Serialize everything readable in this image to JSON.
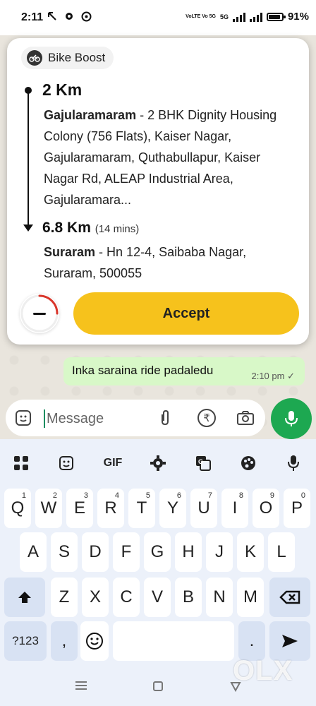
{
  "status_bar": {
    "time": "2:11",
    "network_label": "VoLTE Vo 5G",
    "network_type": "5G",
    "battery": "91%",
    "battery_level": 0.91
  },
  "ride_card": {
    "service_label": "Bike Boost",
    "pickup": {
      "distance": "2 Km",
      "place": "Gajularamaram",
      "address": " - 2 BHK Dignity Housing Colony (756 Flats), Kaiser Nagar, Gajularamaram, Quthabullapur, Kaiser Nagar Rd, ALEAP Industrial Area, Gajularamara..."
    },
    "drop": {
      "distance": "6.8 Km",
      "duration": "(14 mins)",
      "place": "Suraram",
      "address": " - Hn 12-4, Saibaba Nagar, Suraram, 500055"
    },
    "accept_label": "Accept",
    "timer_progress": 0.25,
    "accent_color": "#f6c21c"
  },
  "chat": {
    "message": "Inka saraina ride padaledu",
    "time": "2:10 pm",
    "tick": "✓"
  },
  "composer": {
    "placeholder": "Message",
    "rupee_symbol": "₹"
  },
  "keyboard": {
    "toolbar": {
      "gif_label": "GIF"
    },
    "row1": [
      {
        "k": "Q",
        "s": "1"
      },
      {
        "k": "W",
        "s": "2"
      },
      {
        "k": "E",
        "s": "3"
      },
      {
        "k": "R",
        "s": "4"
      },
      {
        "k": "T",
        "s": "5"
      },
      {
        "k": "Y",
        "s": "6"
      },
      {
        "k": "U",
        "s": "7"
      },
      {
        "k": "I",
        "s": "8"
      },
      {
        "k": "O",
        "s": "9"
      },
      {
        "k": "P",
        "s": "0"
      }
    ],
    "row2": [
      "A",
      "S",
      "D",
      "F",
      "G",
      "H",
      "J",
      "K",
      "L"
    ],
    "row3": [
      "Z",
      "X",
      "C",
      "V",
      "B",
      "N",
      "M"
    ],
    "symbols_label": "?123",
    "comma": ",",
    "period": "."
  },
  "watermark": "OLX"
}
